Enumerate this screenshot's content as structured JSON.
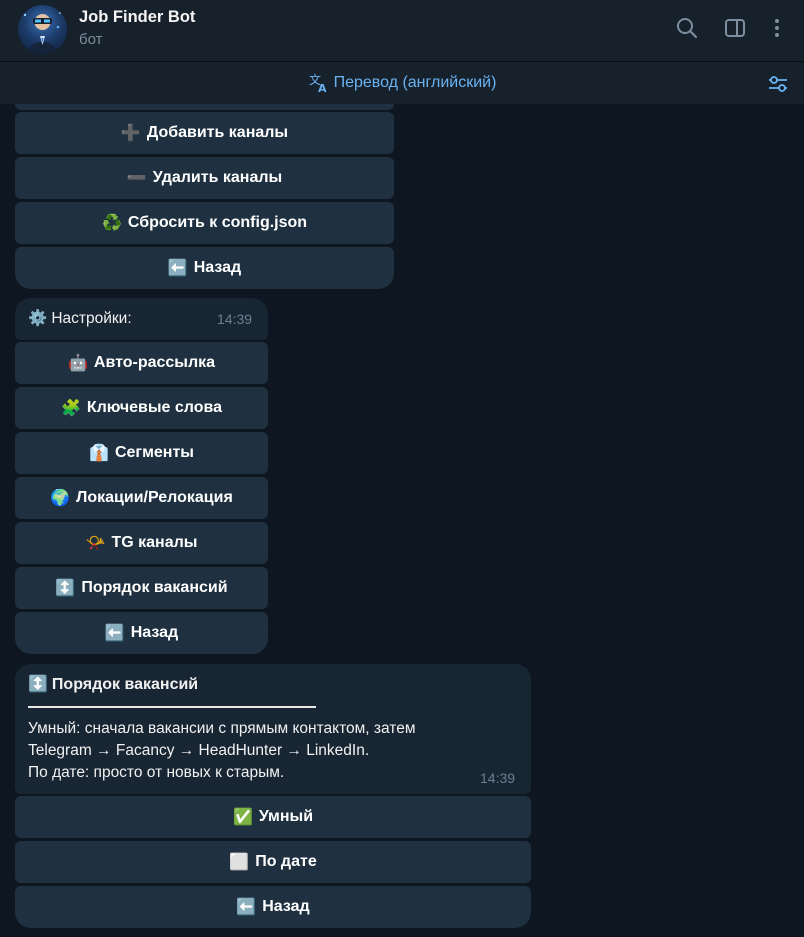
{
  "header": {
    "title": "Job Finder Bot",
    "subtitle": "бот",
    "icons": [
      "search-icon",
      "sidebar-toggle-icon",
      "more-vertical-icon"
    ]
  },
  "translate_bar": {
    "label": "Перевод (английский)",
    "icon": "translate-icon",
    "settings_icon": "translation-settings-icon"
  },
  "channels_keyboard": {
    "buttons": [
      {
        "emoji": "➕",
        "label": "Добавить каналы"
      },
      {
        "emoji": "➖",
        "label": "Удалить каналы"
      },
      {
        "emoji": "♻️",
        "label": "Сбросить к config.json"
      },
      {
        "emoji": "⬅️",
        "label": "Назад"
      }
    ]
  },
  "settings_message": {
    "emoji": "⚙️",
    "text": "Настройки:",
    "time": "14:39",
    "buttons": [
      {
        "emoji": "🤖",
        "label": "Авто-рассылка"
      },
      {
        "emoji": "🧩",
        "label": "Ключевые слова"
      },
      {
        "emoji": "👔",
        "label": "Сегменты"
      },
      {
        "emoji": "🌍",
        "label": "Локации/Релокация"
      },
      {
        "emoji": "📯",
        "label": "TG каналы"
      },
      {
        "emoji": "↕️",
        "label": "Порядок вакансий"
      },
      {
        "emoji": "⬅️",
        "label": "Назад"
      }
    ]
  },
  "order_message": {
    "title_emoji": "↕️",
    "title": "Порядок вакансий",
    "line1": "Умный: сначала вакансии с прямым контактом, затем",
    "line2": "Telegram → Facancy → HeadHunter → LinkedIn.",
    "line3": "По дате: просто от новых к старым.",
    "time": "14:39",
    "buttons": [
      {
        "emoji": "✅",
        "label": "Умный"
      },
      {
        "emoji": "⬜",
        "label": "По дате"
      },
      {
        "emoji": "⬅️",
        "label": "Назад"
      }
    ]
  },
  "colors": {
    "background": "#0e1621",
    "header": "#17212b",
    "bubble": "#182533",
    "button": "#1f3140",
    "accent": "#6ab3f3"
  }
}
